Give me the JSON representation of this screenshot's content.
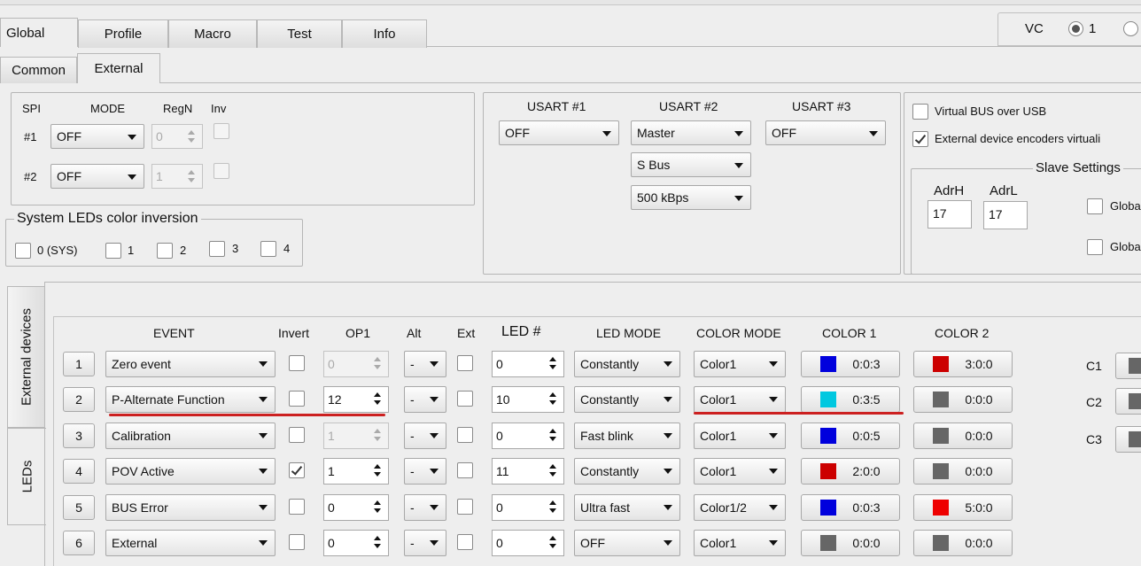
{
  "tabs_main": [
    "Global",
    "Profile",
    "Macro",
    "Test",
    "Info"
  ],
  "tabs_sub": [
    "Common",
    "External"
  ],
  "vc": {
    "label": "VC",
    "option1": "1"
  },
  "spi": {
    "headers": {
      "spi": "SPI",
      "mode": "MODE",
      "regn": "RegN",
      "inv": "Inv"
    },
    "rows": [
      {
        "label": "#1",
        "mode": "OFF",
        "regn": "0"
      },
      {
        "label": "#2",
        "mode": "OFF",
        "regn": "1"
      }
    ]
  },
  "sys_leds": {
    "title": "System LEDs color inversion",
    "items": [
      "0 (SYS)",
      "1",
      "2",
      "3",
      "4"
    ]
  },
  "usart": {
    "headers": [
      "USART #1",
      "USART #2",
      "USART #3"
    ],
    "u1": "OFF",
    "u2": "Master",
    "u2_bus": "S Bus",
    "u2_rate": "500 kBps",
    "u3": "OFF"
  },
  "virtual": {
    "bus_usb": "Virtual BUS over USB",
    "enc_virtual": "External device encoders virtuali",
    "slave_title": "Slave Settings",
    "adrh_label": "AdrH",
    "adrl_label": "AdrL",
    "adrh": "17",
    "adrl": "17",
    "glob1": "Globa",
    "glob2": "Globa"
  },
  "vtabs": [
    "External devices",
    "LEDs"
  ],
  "leds": {
    "headers": {
      "event": "EVENT",
      "invert": "Invert",
      "op1": "OP1",
      "alt": "Alt",
      "ext": "Ext",
      "led": "LED #",
      "led_mode": "LED MODE",
      "color_mode": "COLOR MODE",
      "color1": "COLOR 1",
      "color2": "COLOR 2"
    },
    "rows": [
      {
        "num": "1",
        "event": "Zero event",
        "invert": false,
        "op1": "0",
        "op1_disabled": true,
        "alt": "-",
        "led": "0",
        "led_mode": "Constantly",
        "color_mode": "Color1",
        "c1_color": "#0000dd",
        "c1": "0:0:3",
        "c2_color": "#cc0000",
        "c2": "3:0:0"
      },
      {
        "num": "2",
        "event": "P-Alternate Function",
        "invert": false,
        "op1": "12",
        "op1_disabled": false,
        "alt": "-",
        "led": "10",
        "led_mode": "Constantly",
        "color_mode": "Color1",
        "c1_color": "#00c8e0",
        "c1": "0:3:5",
        "c2_color": "#666666",
        "c2": "0:0:0"
      },
      {
        "num": "3",
        "event": "Calibration",
        "invert": false,
        "op1": "1",
        "op1_disabled": true,
        "alt": "-",
        "led": "0",
        "led_mode": "Fast blink",
        "color_mode": "Color1",
        "c1_color": "#0000dd",
        "c1": "0:0:5",
        "c2_color": "#666666",
        "c2": "0:0:0"
      },
      {
        "num": "4",
        "event": "POV Active",
        "invert": true,
        "op1": "1",
        "op1_disabled": false,
        "alt": "-",
        "led": "11",
        "led_mode": "Constantly",
        "color_mode": "Color1",
        "c1_color": "#cc0000",
        "c1": "2:0:0",
        "c2_color": "#666666",
        "c2": "0:0:0"
      },
      {
        "num": "5",
        "event": "BUS Error",
        "invert": false,
        "op1": "0",
        "op1_disabled": false,
        "alt": "-",
        "led": "0",
        "led_mode": "Ultra fast",
        "color_mode": "Color1/2",
        "c1_color": "#0000dd",
        "c1": "0:0:3",
        "c2_color": "#ee0000",
        "c2": "5:0:0"
      },
      {
        "num": "6",
        "event": "External",
        "invert": false,
        "op1": "0",
        "op1_disabled": false,
        "alt": "-",
        "led": "0",
        "led_mode": "OFF",
        "color_mode": "Color1",
        "c1_color": "#666666",
        "c1": "0:0:0",
        "c2_color": "#666666",
        "c2": "0:0:0"
      }
    ],
    "side_labels": [
      "C1",
      "C2",
      "C3"
    ]
  },
  "accent_red": "#cc2020"
}
